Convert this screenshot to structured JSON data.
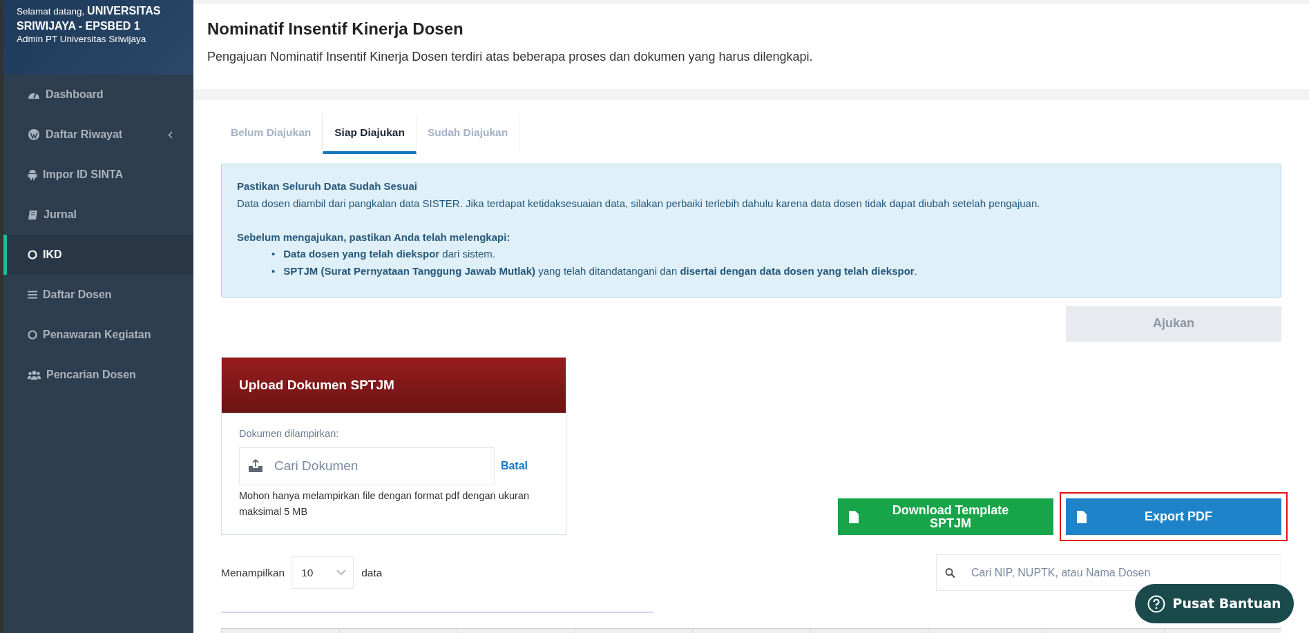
{
  "sidebar": {
    "greeting": "Selamat datang,",
    "institution": "UNIVERSITAS SRIWIJAYA - EPSBED 1",
    "role": "Admin PT Universitas Sriwijaya",
    "items": [
      {
        "label": "Dashboard",
        "kind": "gauge",
        "selected": false,
        "expandable": false
      },
      {
        "label": "Daftar Riwayat",
        "kind": "wp",
        "selected": false,
        "expandable": true
      },
      {
        "label": "Impor ID SINTA",
        "kind": "android",
        "selected": false,
        "expandable": false
      },
      {
        "label": "Jurnal",
        "kind": "book",
        "selected": false,
        "expandable": false
      },
      {
        "label": "IKD",
        "kind": "circle",
        "selected": true,
        "expandable": false
      },
      {
        "label": "Daftar Dosen",
        "kind": "bars",
        "selected": false,
        "expandable": false
      },
      {
        "label": "Penawaran Kegiatan",
        "kind": "circle",
        "selected": false,
        "expandable": false
      },
      {
        "label": "Pencarian Dosen",
        "kind": "users",
        "selected": false,
        "expandable": false
      }
    ]
  },
  "header": {
    "title": "Nominatif Insentif Kinerja Dosen",
    "subtitle": "Pengajuan Nominatif Insentif Kinerja Dosen terdiri atas beberapa proses dan dokumen yang harus dilengkapi."
  },
  "tabs": [
    {
      "label": "Belum Diajukan",
      "selected": false
    },
    {
      "label": "Siap Diajukan",
      "selected": true
    },
    {
      "label": "Sudah Diajukan",
      "selected": false
    }
  ],
  "alert": {
    "title": "Pastikan Seluruh Data Sudah Sesuai",
    "text": "Data dosen diambil dari pangkalan data SISTER. Jika terdapat ketidaksesuaian data, silakan perbaiki terlebih dahulu karena data dosen tidak dapat diubah setelah pengajuan.",
    "checklist_title": "Sebelum mengajukan, pastikan Anda telah melengkapi:",
    "items": [
      {
        "bullet": "•",
        "text": "**Data dosen yang telah diekspor** dari sistem."
      },
      {
        "bullet": "•",
        "text": "**SPTJM (Surat Pernyataan Tanggung Jawab Mutlak)** yang telah ditandatangani dan **disertai dengan data dosen yang telah diekspor**."
      }
    ]
  },
  "submit_button": {
    "label": "Ajukan",
    "disabled": true
  },
  "upload_card": {
    "title": "Upload Dokumen SPTJM",
    "field_label": "Dokumen dilampirkan:",
    "placeholder": "Cari Dokumen",
    "cancel": "Batal",
    "note": "Mohon hanya melampirkan file dengan format pdf dengan ukuran maksimal 5 MB"
  },
  "actions": [
    {
      "label": "Download Template SPTJM",
      "kind": "success",
      "highlighted": false
    },
    {
      "label": "Export PDF",
      "kind": "primary",
      "highlighted": true
    }
  ],
  "page_size": {
    "prefix": "Menampilkan",
    "value": "10",
    "suffix": "data"
  },
  "search": {
    "placeholder": "Cari NIP, NUPTK, atau Nama Dosen"
  },
  "help_button": {
    "label": "Pusat Bantuan"
  }
}
